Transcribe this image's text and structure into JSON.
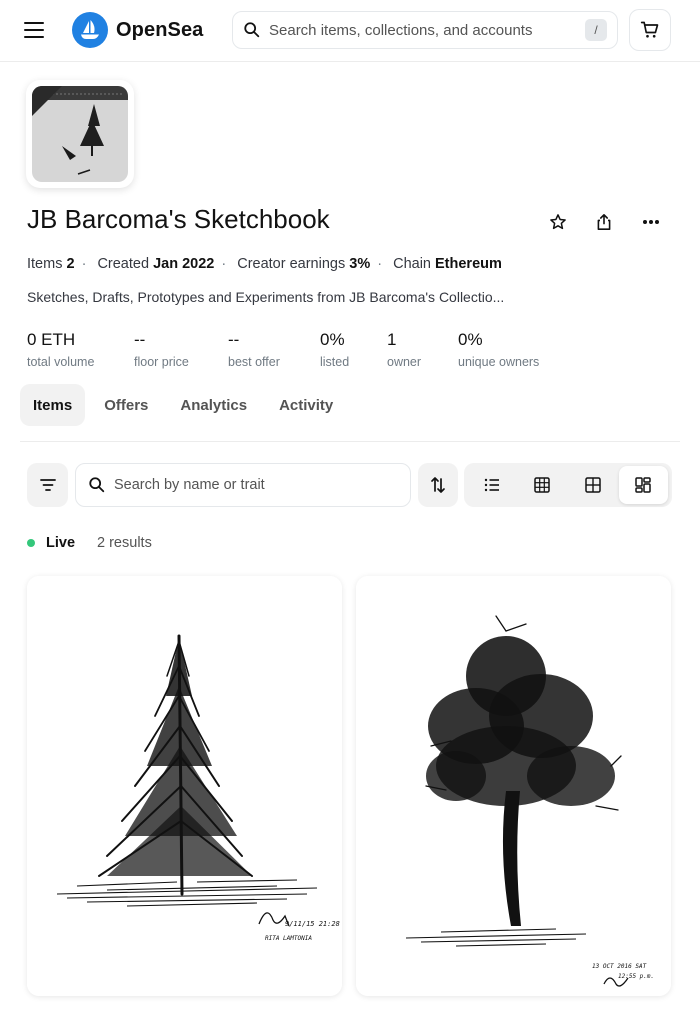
{
  "header": {
    "brand": "OpenSea",
    "search_placeholder": "Search items, collections, and accounts",
    "search_shortcut": "/"
  },
  "collection": {
    "title": "JB Barcoma's Sketchbook",
    "meta": {
      "items_label": "Items",
      "items_value": "2",
      "created_label": "Created",
      "created_value": "Jan 2022",
      "earnings_label": "Creator earnings",
      "earnings_value": "3%",
      "chain_label": "Chain",
      "chain_value": "Ethereum"
    },
    "description": "Sketches, Drafts, Prototypes and Experiments from JB Barcoma's Collectio...",
    "stats": [
      {
        "value": "0 ETH",
        "label": "total volume"
      },
      {
        "value": "--",
        "label": "floor price"
      },
      {
        "value": "--",
        "label": "best offer"
      },
      {
        "value": "0%",
        "label": "listed"
      },
      {
        "value": "1",
        "label": "owner"
      },
      {
        "value": "0%",
        "label": "unique owners"
      }
    ]
  },
  "tabs": [
    {
      "label": "Items",
      "active": true
    },
    {
      "label": "Offers",
      "active": false
    },
    {
      "label": "Analytics",
      "active": false
    },
    {
      "label": "Activity",
      "active": false
    }
  ],
  "toolbar": {
    "search_placeholder": "Search by name or trait",
    "view_modes": [
      "list-icon",
      "grid-small-icon",
      "grid-large-icon",
      "masonry-icon"
    ],
    "active_view": "masonry-icon"
  },
  "status": {
    "live_label": "Live",
    "results": "2 results",
    "live_color": "#34c77b"
  },
  "items": [
    {
      "art": "pine-tree-sketch",
      "caption_lines": [
        "9/11/15 21:28",
        "RITA LAMTONIA"
      ]
    },
    {
      "art": "deciduous-tree-sketch",
      "caption_lines": [
        "13 OCT 2016 SAT",
        "12:55 p.m."
      ]
    }
  ],
  "colors": {
    "accent": "#2081e2",
    "text": "#121212",
    "muted": "#707a83"
  }
}
